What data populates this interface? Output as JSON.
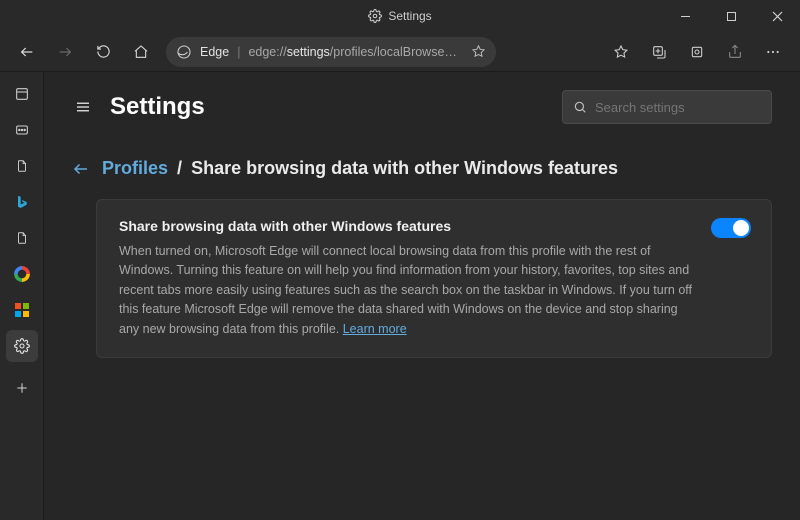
{
  "titlebar": {
    "title": "Settings"
  },
  "toolbar": {
    "brand": "Edge",
    "url_prefix": "edge://",
    "url_highlight": "settings",
    "url_rest": "/profiles/localBrowse…"
  },
  "page": {
    "title": "Settings",
    "search_placeholder": "Search settings"
  },
  "breadcrumb": {
    "link": "Profiles",
    "separator": "/",
    "tail": "Share browsing data with other Windows features"
  },
  "card": {
    "title": "Share browsing data with other Windows features",
    "body": "When turned on, Microsoft Edge will connect local browsing data from this profile with the rest of Windows. Turning this feature on will help you find information from your history, favorites, top sites and recent tabs more easily using features such as the search box on the taskbar in Windows. If you turn off this feature Microsoft Edge will remove the data shared with Windows on the device and stop sharing any new browsing data from this profile. ",
    "learn_more": "Learn more",
    "toggle_on": true
  }
}
